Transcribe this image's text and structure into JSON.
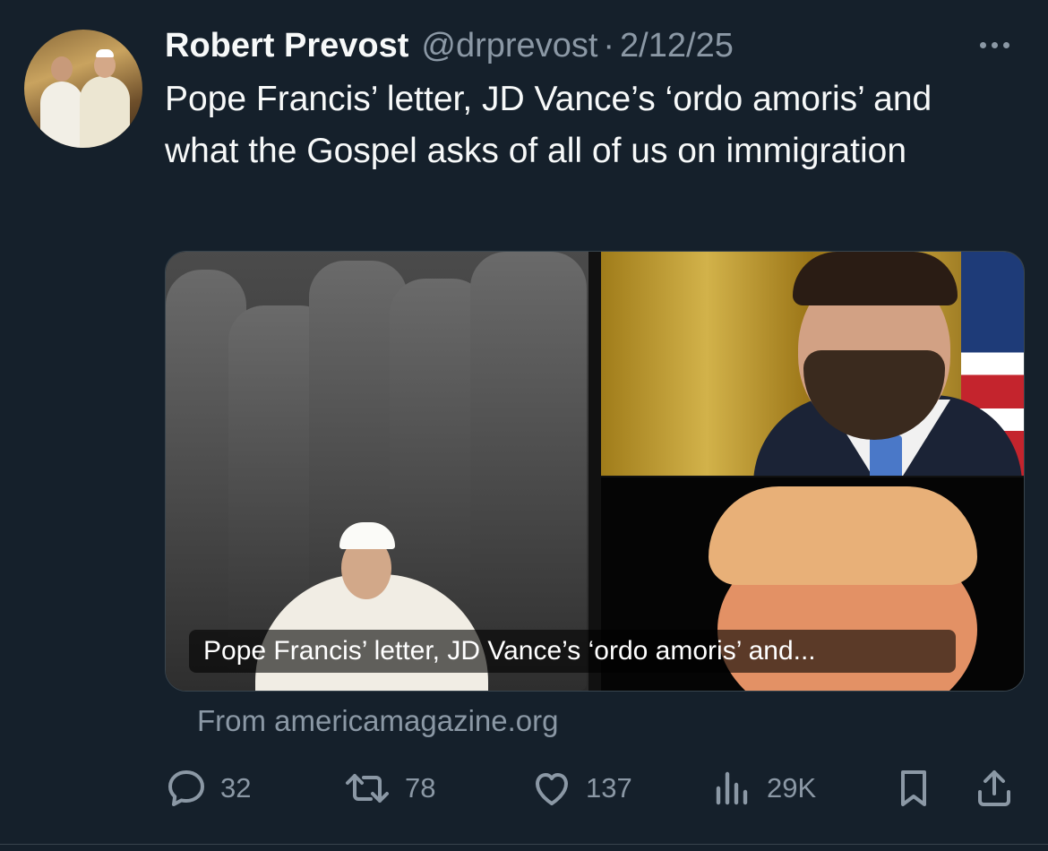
{
  "tweet": {
    "author": {
      "name": "Robert Prevost",
      "handle": "@drprevost"
    },
    "separator": "·",
    "date": "2/12/25",
    "text": "Pope Francis’ letter, JD Vance’s ‘ordo amoris’ and what the Gospel asks of all of us on immigration",
    "card": {
      "caption": "Pope Francis’ letter, JD Vance’s ‘ordo amoris’ and...",
      "source": "From americamagazine.org"
    },
    "actions": {
      "replies": "32",
      "reposts": "78",
      "likes": "137",
      "views": "29K"
    }
  },
  "colors": {
    "background": "#15202b",
    "primary_text": "#f7f9f9",
    "secondary_text": "#8b98a5",
    "border": "#38444d"
  },
  "icons": [
    "more-icon",
    "reply-icon",
    "repost-icon",
    "like-icon",
    "views-icon",
    "bookmark-icon",
    "share-icon"
  ]
}
